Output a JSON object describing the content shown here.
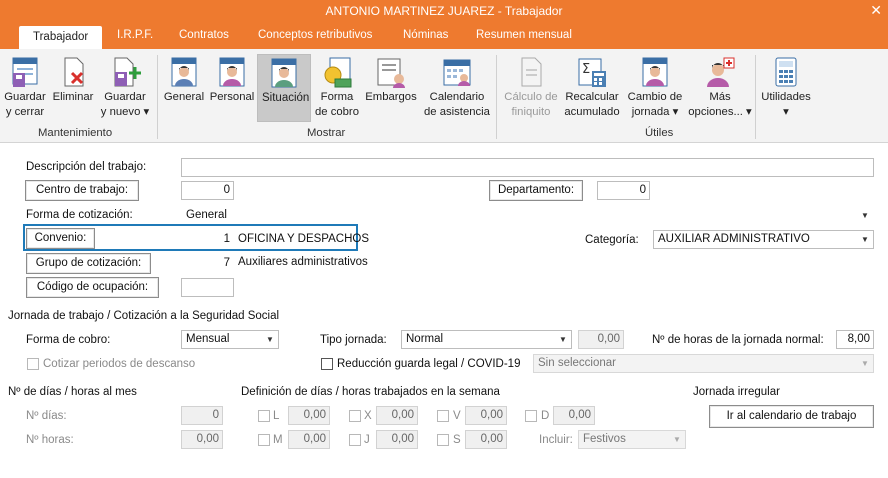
{
  "window": {
    "title": "ANTONIO MARTINEZ JUAREZ - Trabajador",
    "close": "✕"
  },
  "tabs": [
    "Trabajador",
    "I.R.P.F.",
    "Contratos",
    "Conceptos retributivos",
    "Nóminas",
    "Resumen mensual"
  ],
  "ribbon": {
    "guardar_cerrar": [
      "Guardar",
      "y cerrar"
    ],
    "eliminar": "Eliminar",
    "guardar_nuevo": [
      "Guardar",
      "y nuevo ▾"
    ],
    "general": "General",
    "personal": "Personal",
    "situacion": "Situación",
    "forma_cobro": [
      "Forma",
      "de cobro"
    ],
    "embargos": "Embargos",
    "calendario": [
      "Calendario",
      "de asistencia"
    ],
    "calculo": [
      "Cálculo de",
      "finiquito"
    ],
    "recalcular": [
      "Recalcular",
      "acumulado"
    ],
    "cambio": [
      "Cambio de",
      "jornada ▾"
    ],
    "mas": [
      "Más",
      "opciones... ▾"
    ],
    "utilidades": [
      "Utilidades",
      "▾"
    ],
    "groups": {
      "mantenimiento": "Mantenimiento",
      "mostrar": "Mostrar",
      "utiles": "Útiles"
    }
  },
  "form": {
    "descripcion_label": "Descripción del trabajo:",
    "descripcion_value": "",
    "centro_btn": "Centro de trabajo:",
    "centro_value": "0",
    "departamento_btn": "Departamento:",
    "departamento_value": "0",
    "forma_cot_label": "Forma de cotización:",
    "forma_cot_value": "General",
    "convenio_btn": "Convenio:",
    "convenio_value": "1",
    "convenio_name": "OFICINA Y DESPACHOS",
    "categoria_label": "Categoría:",
    "categoria_value": "AUXILIAR ADMINISTRATIVO",
    "grupo_btn": "Grupo de cotización:",
    "grupo_value": "7",
    "grupo_name": "Auxiliares administrativos",
    "ocupacion_btn": "Código de ocupación:",
    "ocupacion_value": ""
  },
  "jornada": {
    "section": "Jornada de trabajo / Cotización a la Seguridad Social",
    "forma_cobro_label": "Forma de cobro:",
    "forma_cobro_value": "Mensual",
    "tipo_label": "Tipo jornada:",
    "tipo_value": "Normal",
    "tipo_num": "0,00",
    "horas_label": "Nº de horas de la jornada normal:",
    "horas_value": "8,00",
    "cotizar_label": "Cotizar periodos de descanso",
    "reduccion_label": "Reducción guarda legal / COVID-19",
    "reduccion_value": "Sin seleccionar"
  },
  "dias": {
    "section_mes": "Nº de días / horas al mes",
    "dias_label": "Nº días:",
    "dias_value": "0",
    "horas_label": "Nº horas:",
    "horas_value": "0,00",
    "section_semana": "Definición de días / horas trabajados en la semana",
    "L": "L",
    "M": "M",
    "X": "X",
    "J": "J",
    "V": "V",
    "S": "S",
    "D": "D",
    "vL": "0,00",
    "vM": "0,00",
    "vX": "0,00",
    "vJ": "0,00",
    "vV": "0,00",
    "vS": "0,00",
    "vD": "0,00",
    "incluir_label": "Incluir:",
    "incluir_value": "Festivos",
    "irregular_section": "Jornada irregular",
    "calendario_btn": "Ir al calendario de trabajo"
  },
  "colors": {
    "accent": "#ee7a2f",
    "highlight": "#1f7ab8"
  }
}
